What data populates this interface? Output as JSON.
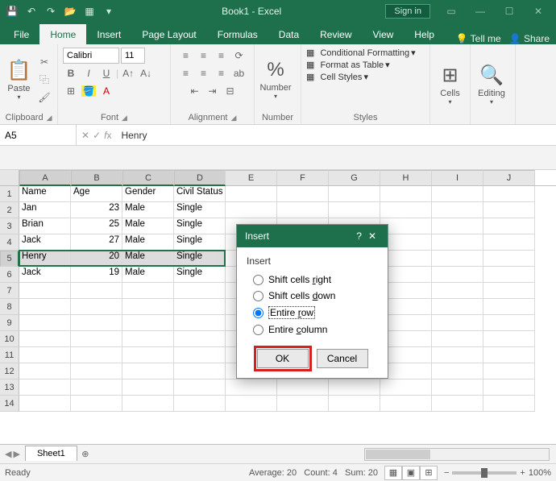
{
  "title": "Book1 - Excel",
  "signin": "Sign in",
  "tabs": [
    "File",
    "Home",
    "Insert",
    "Page Layout",
    "Formulas",
    "Data",
    "Review",
    "View",
    "Help"
  ],
  "active_tab": "Home",
  "tellme": "Tell me",
  "share": "Share",
  "ribbon": {
    "clipboard": {
      "label": "Clipboard",
      "paste": "Paste"
    },
    "font": {
      "label": "Font",
      "name": "Calibri",
      "size": "11"
    },
    "alignment": {
      "label": "Alignment"
    },
    "number": {
      "label": "Number",
      "btn": "Number",
      "fmt": "%"
    },
    "styles": {
      "label": "Styles",
      "cf": "Conditional Formatting",
      "ft": "Format as Table",
      "cs": "Cell Styles"
    },
    "cells": {
      "label": "Cells",
      "btn": "Cells"
    },
    "editing": {
      "label": "Editing",
      "btn": "Editing"
    }
  },
  "namebox": "A5",
  "formula": "Henry",
  "columns": [
    "A",
    "B",
    "C",
    "D",
    "E",
    "F",
    "G",
    "H",
    "I",
    "J"
  ],
  "data_rows": [
    {
      "r": "1",
      "cells": [
        "Name",
        "Age",
        "Gender",
        "Civil Status"
      ]
    },
    {
      "r": "2",
      "cells": [
        "Jan",
        "23",
        "Male",
        "Single"
      ]
    },
    {
      "r": "3",
      "cells": [
        "Brian",
        "25",
        "Male",
        "Single"
      ]
    },
    {
      "r": "4",
      "cells": [
        "Jack",
        "27",
        "Male",
        "Single"
      ]
    },
    {
      "r": "5",
      "cells": [
        "Henry",
        "20",
        "Male",
        "Single"
      ],
      "selected": true
    },
    {
      "r": "6",
      "cells": [
        "Jack",
        "19",
        "Male",
        "Single"
      ]
    },
    {
      "r": "7",
      "cells": []
    },
    {
      "r": "8",
      "cells": []
    },
    {
      "r": "9",
      "cells": []
    },
    {
      "r": "10",
      "cells": []
    },
    {
      "r": "11",
      "cells": []
    },
    {
      "r": "12",
      "cells": []
    },
    {
      "r": "13",
      "cells": []
    },
    {
      "r": "14",
      "cells": []
    }
  ],
  "sheet_tab": "Sheet1",
  "status": {
    "ready": "Ready",
    "avg": "Average: 20",
    "count": "Count: 4",
    "sum": "Sum: 20",
    "zoom": "100%"
  },
  "dialog": {
    "title": "Insert",
    "help": "?",
    "close": "✕",
    "group": "Insert",
    "opts": {
      "right": {
        "pre": "Shift cells ",
        "u": "r",
        "post": "ight"
      },
      "down": {
        "pre": "Shift cells ",
        "u": "d",
        "post": "own"
      },
      "row": {
        "pre": "Entire ",
        "u": "r",
        "post": "ow"
      },
      "col": {
        "pre": "Entire ",
        "u": "c",
        "post": "olumn"
      }
    },
    "ok": "OK",
    "cancel": "Cancel"
  }
}
